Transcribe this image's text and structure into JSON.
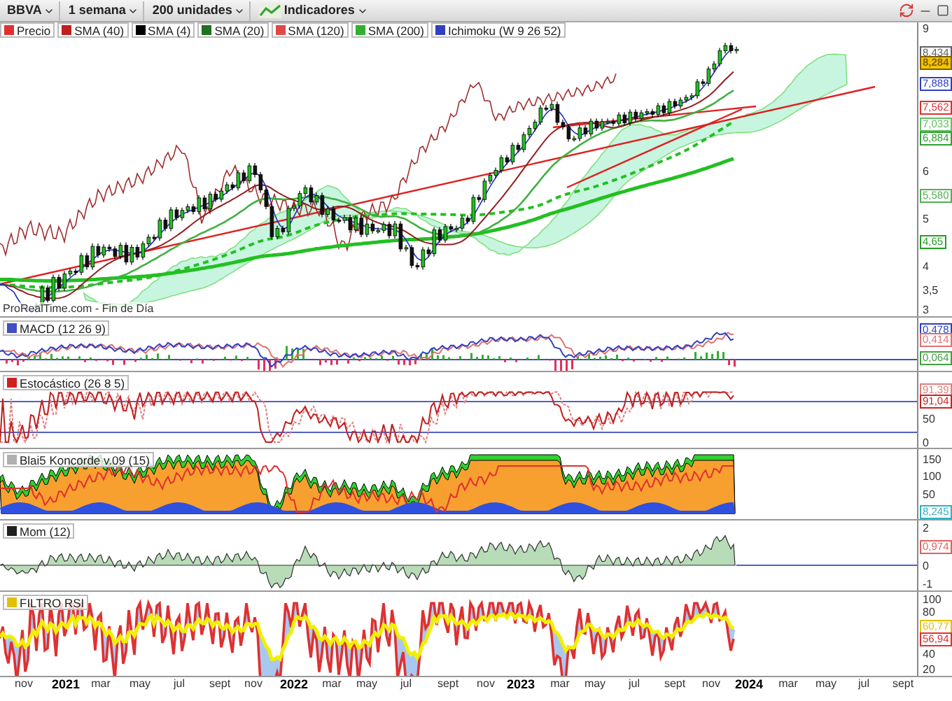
{
  "toolbar": {
    "symbol": "BBVA",
    "timeframe": "1 semana",
    "units": "200 unidades",
    "indicators": "Indicadores"
  },
  "legend": [
    {
      "label": "Precio",
      "color": "#e03030"
    },
    {
      "label": "SMA (40)",
      "color": "#c02020"
    },
    {
      "label": "SMA (4)",
      "color": "#000000"
    },
    {
      "label": "SMA (20)",
      "color": "#207020"
    },
    {
      "label": "SMA (120)",
      "color": "#e04848"
    },
    {
      "label": "SMA (200)",
      "color": "#30b030"
    },
    {
      "label": "Ichimoku (W 9 26 52)",
      "color": "#3040c0"
    }
  ],
  "main": {
    "source_note": "ProRealTime.com - Fin de Día",
    "ticks": [
      "9",
      "6",
      "5",
      "4",
      "3,5",
      "3"
    ],
    "tags": [
      {
        "text": "8,434",
        "color": "#606060",
        "highlighted": false
      },
      {
        "text": "8,284",
        "color": "#806000",
        "highlighted": true
      },
      {
        "text": "7,888",
        "color": "#3040c0",
        "highlighted": false
      },
      {
        "text": "7,562",
        "color": "#e03030",
        "highlighted": false
      },
      {
        "text": "7,033",
        "color": "#60c060",
        "highlighted": false
      },
      {
        "text": "6,884",
        "color": "#30a030",
        "highlighted": false
      },
      {
        "text": "5,580",
        "color": "#50b050",
        "highlighted": false
      },
      {
        "text": "4,65",
        "color": "#20a020",
        "highlighted": false
      }
    ]
  },
  "panels": [
    {
      "kind": "macd",
      "label": "MACD (12 26 9)",
      "color": "#4050c0",
      "tags": [
        {
          "text": "0,478",
          "color": "#3040c0",
          "highlighted": false
        },
        {
          "text": "0,414",
          "color": "#e07070",
          "highlighted": false
        },
        {
          "text": "0,064",
          "color": "#40a040",
          "highlighted": false
        }
      ]
    },
    {
      "kind": "stochastic",
      "label": "Estocástico (26 8 5)",
      "color": "#d02020",
      "ticks": [
        "50",
        "0"
      ],
      "tags": [
        {
          "text": "91,39",
          "color": "#e08080",
          "highlighted": false
        },
        {
          "text": "91,04",
          "color": "#d02020",
          "highlighted": false
        }
      ]
    },
    {
      "kind": "blai5",
      "label": "Blai5 Koncorde v.09 (15)",
      "color": "#b0b0b0",
      "ticks": [
        "150",
        "100",
        "50"
      ],
      "tags": [
        {
          "text": "8,245",
          "color": "#30b0c0",
          "highlighted": false
        }
      ]
    },
    {
      "kind": "momentum",
      "label": "Mom (12)",
      "color": "#202020",
      "ticks": [
        "2",
        "0",
        "-1"
      ],
      "tags": [
        {
          "text": "0,974",
          "color": "#e06060",
          "highlighted": false
        }
      ]
    },
    {
      "kind": "rsi",
      "label": "FILTRO RSI",
      "color": "#e0c000",
      "ticks": [
        "100",
        "80",
        "40",
        "20"
      ],
      "tags": [
        {
          "text": "60,77",
          "color": "#e0c000",
          "highlighted": false
        },
        {
          "text": "56,94",
          "color": "#e03030",
          "highlighted": false
        }
      ]
    }
  ],
  "x_axis": [
    {
      "label": "nov",
      "kind": "month"
    },
    {
      "label": "2021",
      "kind": "year"
    },
    {
      "label": "mar",
      "kind": "month"
    },
    {
      "label": "may",
      "kind": "month"
    },
    {
      "label": "jul",
      "kind": "month"
    },
    {
      "label": "sept",
      "kind": "month"
    },
    {
      "label": "nov",
      "kind": "month"
    },
    {
      "label": "2022",
      "kind": "year"
    },
    {
      "label": "mar",
      "kind": "month"
    },
    {
      "label": "may",
      "kind": "month"
    },
    {
      "label": "jul",
      "kind": "month"
    },
    {
      "label": "sept",
      "kind": "month"
    },
    {
      "label": "nov",
      "kind": "month"
    },
    {
      "label": "2023",
      "kind": "year"
    },
    {
      "label": "mar",
      "kind": "month"
    },
    {
      "label": "may",
      "kind": "month"
    },
    {
      "label": "jul",
      "kind": "month"
    },
    {
      "label": "sept",
      "kind": "month"
    },
    {
      "label": "nov",
      "kind": "month"
    },
    {
      "label": "2024",
      "kind": "year"
    },
    {
      "label": "mar",
      "kind": "month"
    },
    {
      "label": "may",
      "kind": "month"
    },
    {
      "label": "jul",
      "kind": "month"
    },
    {
      "label": "sept",
      "kind": "month"
    }
  ]
}
